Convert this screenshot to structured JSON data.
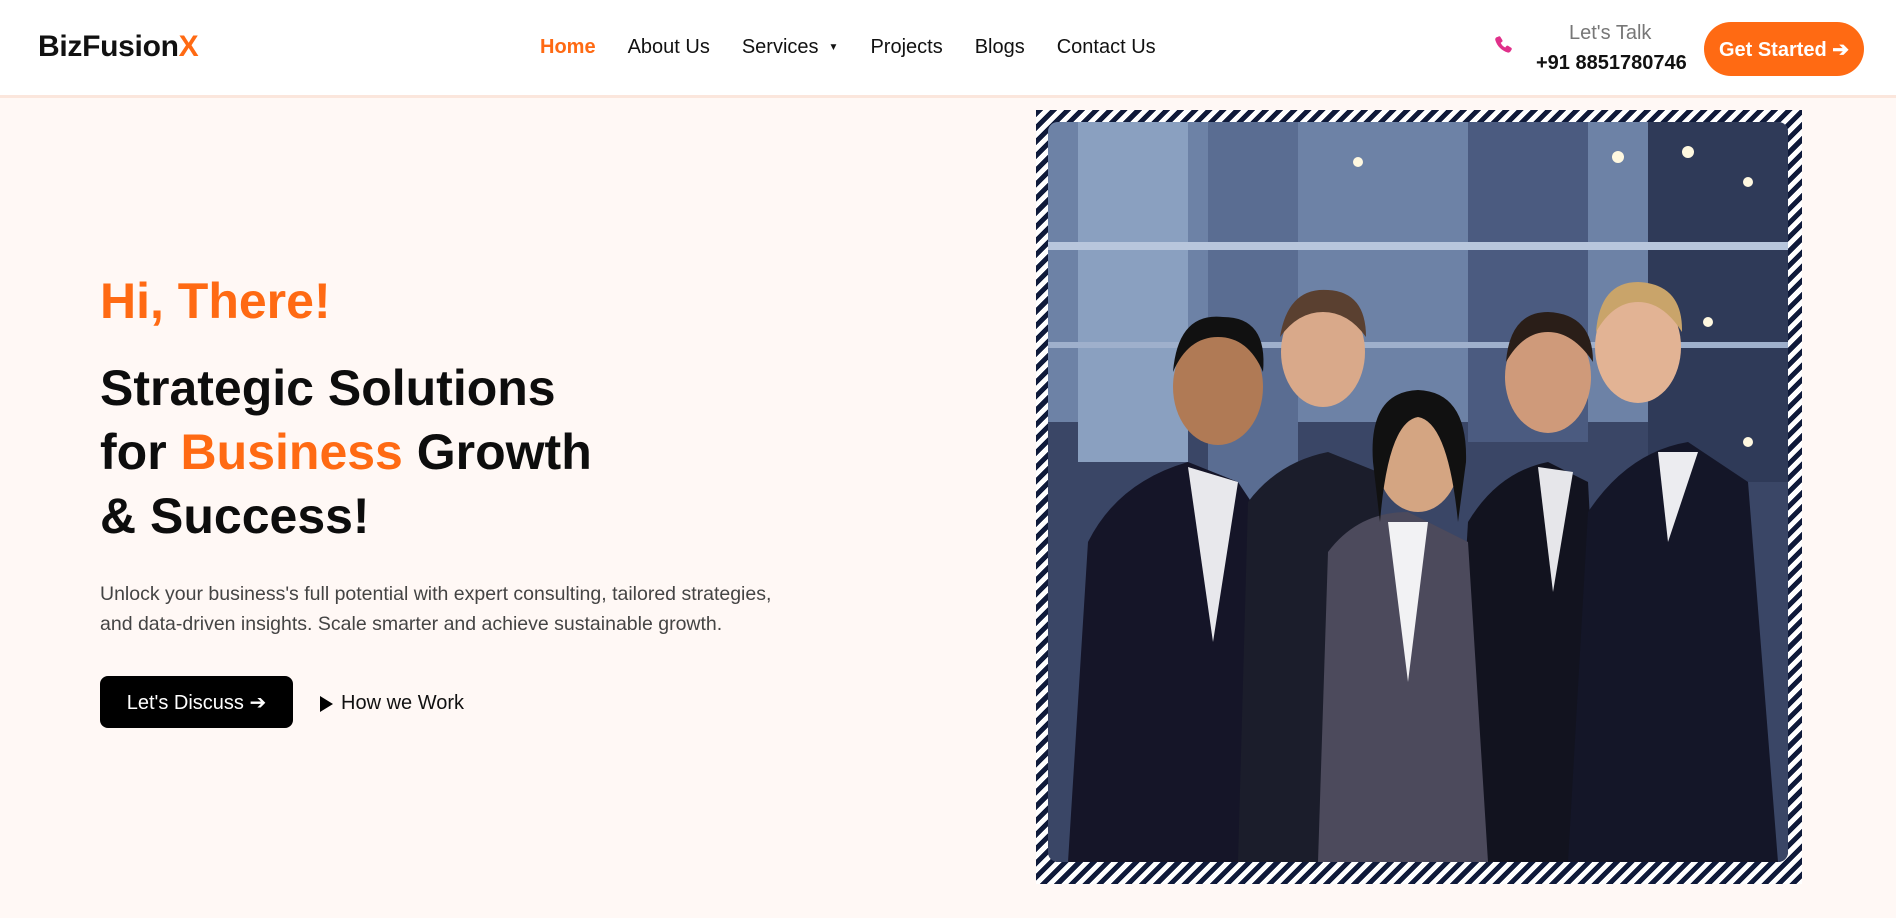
{
  "header": {
    "logo_main": "BizFusion",
    "logo_accent": "X",
    "nav": [
      {
        "label": "Home",
        "active": true
      },
      {
        "label": "About Us",
        "active": false
      },
      {
        "label": "Services",
        "active": false,
        "dropdown": true
      },
      {
        "label": "Projects",
        "active": false
      },
      {
        "label": "Blogs",
        "active": false
      },
      {
        "label": "Contact Us",
        "active": false
      }
    ],
    "talk_label": "Let's Talk",
    "phone": "+91 8851780746",
    "phone_icon": "phone-icon",
    "cta_label": "Get Started ➔"
  },
  "hero": {
    "greeting": "Hi, There!",
    "headline_line1": "Strategic Solutions",
    "headline_line2_pre": "for ",
    "headline_line2_highlight": "Business",
    "headline_line2_post": " Growth",
    "headline_line3": "& Success!",
    "description_line1": "Unlock your business's full potential with expert consulting, tailored strategies,",
    "description_line2": "and data-driven insights. Scale smarter and achieve sustainable growth.",
    "primary_button": "Let's Discuss ➔",
    "secondary_link": "How we Work"
  },
  "colors": {
    "accent": "#ff6a13",
    "background": "#fff8f5",
    "frame_stripe": "#0f1a3a"
  }
}
